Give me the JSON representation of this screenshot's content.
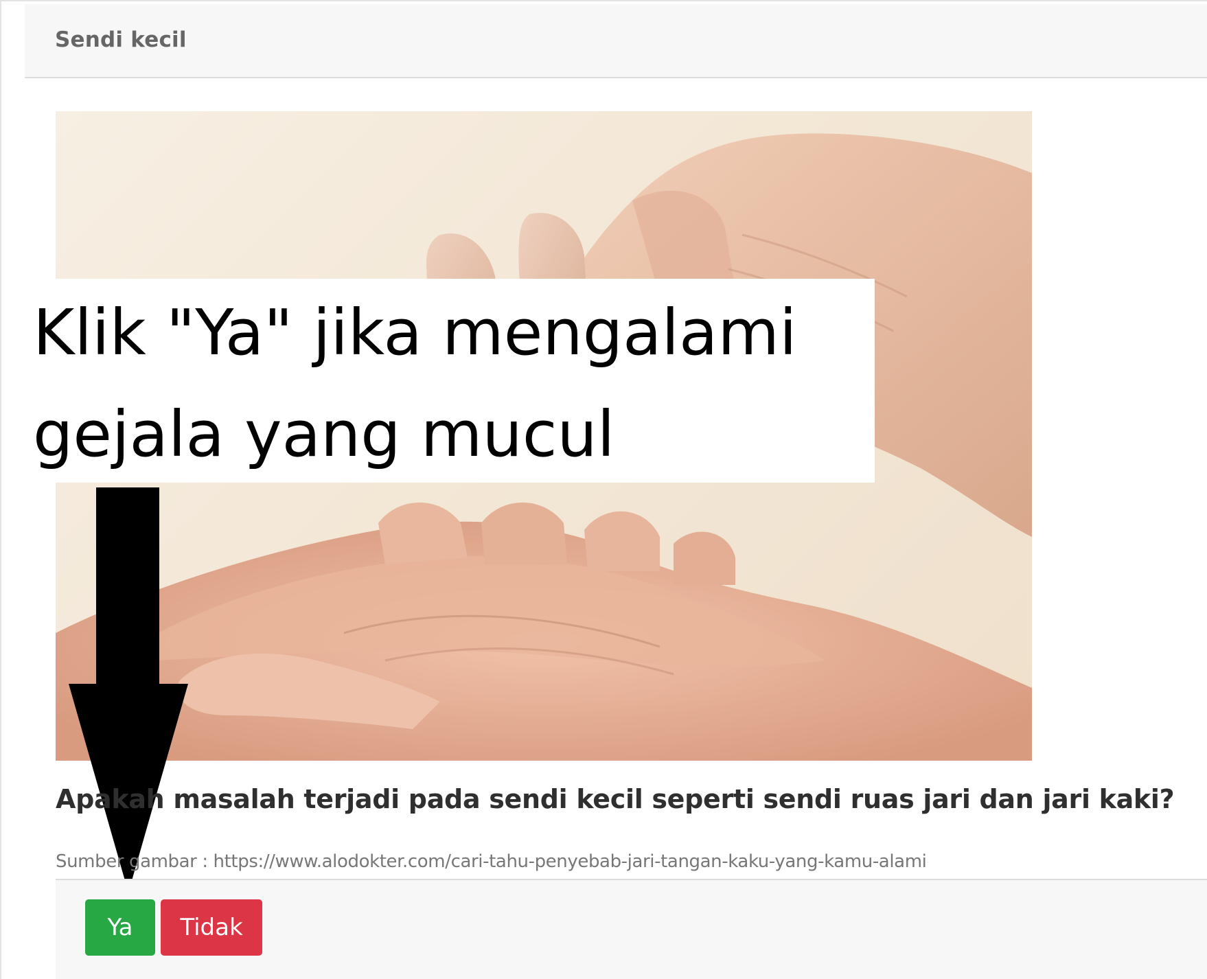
{
  "card": {
    "title": "Sendi kecil"
  },
  "annotation": {
    "line1": "Klik \"Ya\" jika mengalami",
    "line2": "gejala yang mucul"
  },
  "question": {
    "text": "Apakah masalah terjadi pada sendi kecil seperti sendi ruas jari dan jari kaki?"
  },
  "source": {
    "text": "Sumber gambar : https://www.alodokter.com/cari-tahu-penyebab-jari-tangan-kaku-yang-kamu-alami"
  },
  "buttons": {
    "yes_label": "Ya",
    "no_label": "Tidak"
  },
  "colors": {
    "yes": "#28a745",
    "no": "#dc3545",
    "header_bg": "#f7f7f7"
  }
}
